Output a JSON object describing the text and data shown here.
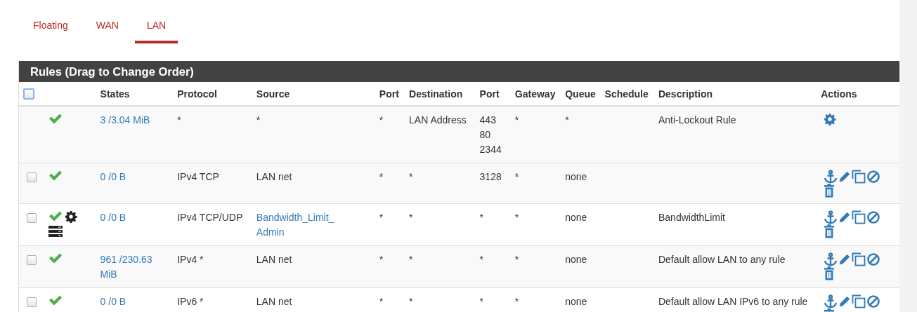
{
  "tabs": [
    {
      "label": "Floating",
      "selected": false
    },
    {
      "label": "WAN",
      "selected": false
    },
    {
      "label": "LAN",
      "selected": true
    }
  ],
  "panel": {
    "title": "Rules (Drag to Change Order)"
  },
  "table": {
    "select_all": {
      "checked": false
    },
    "columns": [
      "States",
      "Protocol",
      "Source",
      "Port",
      "Destination",
      "Port",
      "Gateway",
      "Queue",
      "Schedule",
      "Description",
      "Actions"
    ],
    "rows": [
      {
        "kind": "fixed",
        "status_icons": [
          {
            "kind": "pass"
          }
        ],
        "states": "3 /3.04 MiB",
        "protocol": "*",
        "source": "*",
        "source_link": false,
        "source_port": "*",
        "destination": "LAN Address",
        "destination_port": "443\n80\n2344",
        "gateway": "*",
        "queue": "*",
        "description": "Anti-Lockout Rule"
      },
      {
        "kind": "user",
        "checked": false,
        "status_icons": [
          {
            "kind": "pass"
          }
        ],
        "states": "0 /0 B",
        "protocol": "IPv4 TCP",
        "source": "LAN net",
        "source_link": false,
        "source_port": "*",
        "destination": "*",
        "destination_port": "3128",
        "gateway": "*",
        "queue": "none",
        "description": ""
      },
      {
        "kind": "user",
        "checked": false,
        "status_icons": [
          {
            "kind": "pass"
          },
          {
            "kind": "advanced"
          },
          {
            "kind": "limiter"
          }
        ],
        "states": "0 /0 B",
        "protocol": "IPv4 TCP/UDP",
        "source": "Bandwidth_Limit_ Admin",
        "source_link": true,
        "source_port": "*",
        "destination": "*",
        "destination_port": "*",
        "gateway": "*",
        "queue": "none",
        "description": "BandwidthLimit"
      },
      {
        "kind": "user",
        "checked": false,
        "status_icons": [
          {
            "kind": "pass"
          }
        ],
        "states": "961 /230.63 MiB",
        "protocol": "IPv4 *",
        "source": "LAN net",
        "source_link": false,
        "source_port": "*",
        "destination": "*",
        "destination_port": "*",
        "gateway": "*",
        "queue": "none",
        "description": "Default allow LAN to any rule"
      },
      {
        "kind": "user",
        "checked": false,
        "status_icons": [
          {
            "kind": "pass"
          }
        ],
        "states": "0 /0 B",
        "protocol": "IPv6 *",
        "source": "LAN net",
        "source_link": false,
        "source_port": "*",
        "destination": "*",
        "destination_port": "*",
        "gateway": "*",
        "queue": "none",
        "description": "Default allow LAN IPv6 to any rule"
      }
    ]
  }
}
